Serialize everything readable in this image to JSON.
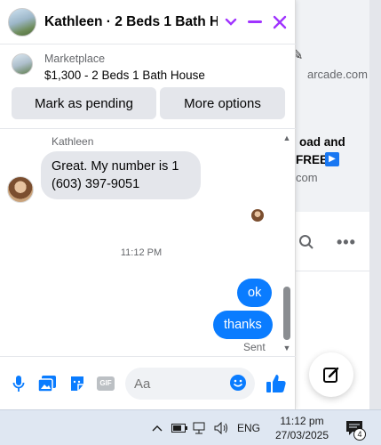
{
  "background": {
    "text_domain1": "arcade.com",
    "text_line1": "oad and",
    "text_line2": "FREE",
    "text_domain2": "com"
  },
  "chat": {
    "title": "Kathleen · 2 Beds 1 Bath H…",
    "listing_label": "Marketplace",
    "listing_price": "$1,300 - 2 Beds 1 Bath House",
    "mark_pending_label": "Mark as pending",
    "more_options_label": "More options",
    "sender_name": "Kathleen",
    "incoming_message": "Great. My number is 1 (603) 397-9051",
    "timestamp": "11:12 PM",
    "outgoing_messages": [
      "ok",
      "thanks"
    ],
    "sent_status": "Sent",
    "composer_placeholder": "Aa"
  },
  "taskbar": {
    "language": "ENG",
    "time": "11:12 pm",
    "date": "27/03/2025",
    "notification_count": "4"
  },
  "colors": {
    "accent": "#a033ff",
    "messenger_blue": "#0a7cff",
    "incoming_bubble": "#e4e6eb"
  }
}
